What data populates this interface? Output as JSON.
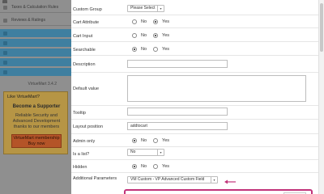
{
  "sidebar": {
    "items": [
      {
        "label": "Taxes & Calculation Rules",
        "style": "plain"
      },
      {
        "label": "Reviews & Ratings",
        "style": "plain"
      },
      {
        "label": "",
        "style": "blue"
      },
      {
        "label": "",
        "style": "blue"
      },
      {
        "label": "",
        "style": "blue"
      },
      {
        "label": "",
        "style": "blue"
      },
      {
        "label": "",
        "style": "blue"
      }
    ],
    "version": "VirtueMart 3.4.2",
    "supporter": {
      "like_text": "Like VirtueMart?",
      "title": "Become a Supporter",
      "body": [
        "Reliable Security and",
        "Advanced Development",
        "thanks to our members"
      ],
      "button": [
        "VirtueMart membership",
        "Buy now"
      ]
    }
  },
  "form": {
    "custom_group": {
      "label": "Custom Group",
      "value": "Please Select"
    },
    "cart_attribute": {
      "label": "Cart Attribute",
      "options": [
        "No",
        "Yes"
      ],
      "selected": "Yes"
    },
    "cart_input": {
      "label": "Cart Input",
      "options": [
        "No",
        "Yes"
      ],
      "selected": "Yes"
    },
    "searchable": {
      "label": "Searchable",
      "options": [
        "No",
        "Yes"
      ],
      "selected": "No"
    },
    "description": {
      "label": "Description",
      "value": ""
    },
    "default_value": {
      "label": "Default value",
      "value": ""
    },
    "tooltip": {
      "label": "Tooltip",
      "value": ""
    },
    "layout_position": {
      "label": "Layout position",
      "value": "addtocart"
    },
    "admin_only": {
      "label": "Admin only",
      "options": [
        "No",
        "Yes"
      ],
      "selected": "No"
    },
    "is_list": {
      "label": "Is a list?",
      "value": "No"
    },
    "hidden": {
      "label": "Hidden",
      "options": [
        "No",
        "Yes"
      ],
      "selected": "No"
    },
    "additional_parameters": {
      "label": "Additional Parameters",
      "value": "VM Custom - VP Advanced Custom Field"
    }
  },
  "colors": {
    "sidebar_bg": "#8f8f8f",
    "sidebar_blue": "#3f7fa0",
    "supporter_bg": "#b69545",
    "membership_button": "#b45428",
    "highlight": "#c1337a"
  }
}
